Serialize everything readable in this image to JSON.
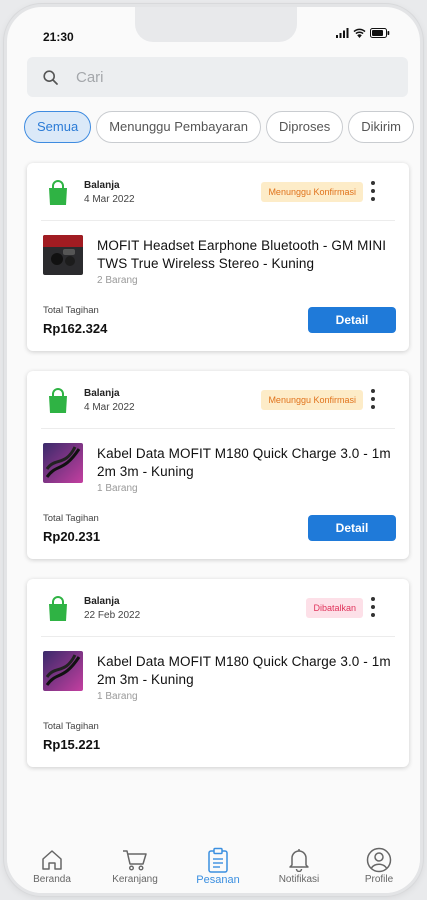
{
  "status": {
    "time": "21:30"
  },
  "search": {
    "placeholder": "Cari"
  },
  "tabs": [
    {
      "label": "Semua",
      "active": true
    },
    {
      "label": "Menunggu Pembayaran",
      "active": false
    },
    {
      "label": "Diproses",
      "active": false
    },
    {
      "label": "Dikirim",
      "active": false
    }
  ],
  "orders": [
    {
      "shop_label": "Balanja",
      "date": "4 Mar 2022",
      "status": "Menunggu Konfirmasi",
      "product": "MOFIT Headset Earphone Bluetooth - GM MINI TWS True Wireless Stereo - Kuning",
      "qty": "2 Barang",
      "total_label": "Total Tagihan",
      "total": "Rp162.324",
      "action": "Detail"
    },
    {
      "shop_label": "Balanja",
      "date": "4 Mar 2022",
      "status": "Menunggu Konfirmasi",
      "product": "Kabel Data MOFIT M180 Quick Charge 3.0 - 1m 2m 3m - Kuning",
      "qty": "1 Barang",
      "total_label": "Total Tagihan",
      "total": "Rp20.231",
      "action": "Detail"
    },
    {
      "shop_label": "Balanja",
      "date": "22 Feb 2022",
      "status": "Dibatalkan",
      "product": "Kabel Data MOFIT M180 Quick Charge 3.0 - 1m 2m 3m - Kuning",
      "qty": "1 Barang",
      "total_label": "Total Tagihan",
      "total": "Rp15.221"
    }
  ],
  "nav": [
    {
      "label": "Beranda",
      "icon": "home-icon"
    },
    {
      "label": "Keranjang",
      "icon": "cart-icon"
    },
    {
      "label": "Pesanan",
      "icon": "clipboard-icon",
      "active": true
    },
    {
      "label": "Notifikasi",
      "icon": "bell-icon"
    },
    {
      "label": "Profile",
      "icon": "user-icon"
    }
  ],
  "colors": {
    "accent": "#1f7ad9",
    "pending": "#e0731c",
    "cancelled": "#e0335b",
    "shop": "#2fb344"
  }
}
